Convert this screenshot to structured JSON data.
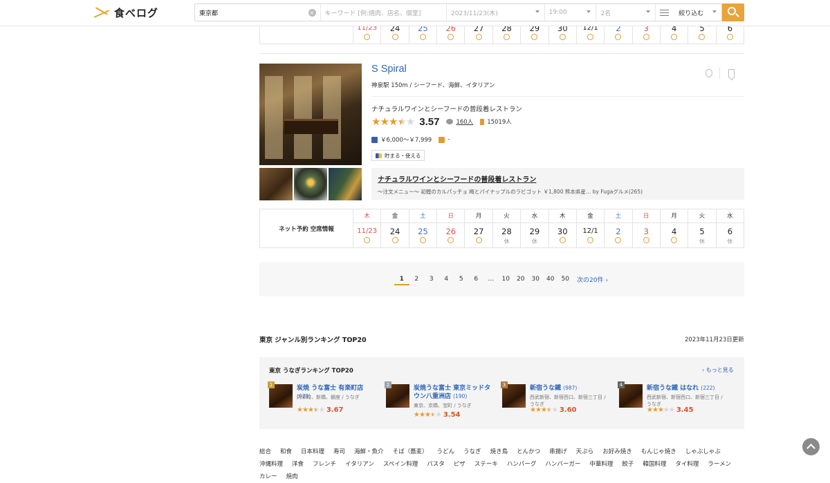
{
  "header": {
    "logo_text": "食べログ",
    "area_value": "東京都",
    "keyword_placeholder": "キーワード [例:焼肉、店名、個室]",
    "date_value": "2023/11/23(木)",
    "time_value": "19:00",
    "people_value": "2名",
    "filter_label": "絞り込む"
  },
  "top_calendar": {
    "days": [
      {
        "date": "11/23",
        "mark": "circle",
        "color": "red"
      },
      {
        "date": "24",
        "mark": "circle",
        "color": ""
      },
      {
        "date": "25",
        "mark": "circle",
        "color": "blue"
      },
      {
        "date": "26",
        "mark": "circle",
        "color": "red"
      },
      {
        "date": "27",
        "mark": "circle",
        "color": ""
      },
      {
        "date": "28",
        "mark": "circle",
        "color": ""
      },
      {
        "date": "29",
        "mark": "circle",
        "color": ""
      },
      {
        "date": "30",
        "mark": "circle",
        "color": ""
      },
      {
        "date": "12/1",
        "mark": "circle",
        "color": ""
      },
      {
        "date": "2",
        "mark": "circle",
        "color": "blue"
      },
      {
        "date": "3",
        "mark": "circle",
        "color": "red"
      },
      {
        "date": "4",
        "mark": "circle",
        "color": ""
      },
      {
        "date": "5",
        "mark": "circle",
        "color": ""
      },
      {
        "date": "6",
        "mark": "circle",
        "color": ""
      }
    ]
  },
  "restaurant": {
    "name": "S Spiral",
    "meta": "神泉駅 150m / シーフード、海鮮、イタリアン",
    "catch": "ナチュラルワインとシーフードの普段着レストラン",
    "score": "3.57",
    "stars_full": 3.5,
    "review_count": "160人",
    "save_count": "15019人",
    "dinner_price": "￥6,000～￥7,999",
    "lunch_price": "-",
    "point_label": "貯まる・使える",
    "review_title": "ナチュラルワインとシーフードの普段着レストラン",
    "review_snippet": "〜注文メニュー〜 初鰹のカルパッチョ 梅とパイナップルのラビゴット ￥1,800 熊本県産…",
    "review_author": "by Fugaグルメ(265)"
  },
  "calendar": {
    "label": "ネット予約 空席情報",
    "days": [
      {
        "wd": "木",
        "date": "11/23",
        "mark": "circle",
        "color": "red"
      },
      {
        "wd": "金",
        "date": "24",
        "mark": "circle",
        "color": ""
      },
      {
        "wd": "土",
        "date": "25",
        "mark": "circle",
        "color": "blue"
      },
      {
        "wd": "日",
        "date": "26",
        "mark": "circle",
        "color": "red"
      },
      {
        "wd": "月",
        "date": "27",
        "mark": "circle",
        "color": ""
      },
      {
        "wd": "火",
        "date": "28",
        "mark": "休",
        "color": ""
      },
      {
        "wd": "水",
        "date": "29",
        "mark": "休",
        "color": ""
      },
      {
        "wd": "木",
        "date": "30",
        "mark": "circle",
        "color": ""
      },
      {
        "wd": "金",
        "date": "12/1",
        "mark": "circle",
        "color": ""
      },
      {
        "wd": "土",
        "date": "2",
        "mark": "circle",
        "color": "blue"
      },
      {
        "wd": "日",
        "date": "3",
        "mark": "circle",
        "color": "red"
      },
      {
        "wd": "月",
        "date": "4",
        "mark": "circle",
        "color": ""
      },
      {
        "wd": "火",
        "date": "5",
        "mark": "休",
        "color": ""
      },
      {
        "wd": "水",
        "date": "6",
        "mark": "休",
        "color": ""
      }
    ]
  },
  "pagination": {
    "pages": [
      "1",
      "2",
      "3",
      "4",
      "5",
      "6",
      "…",
      "10",
      "20",
      "30",
      "40",
      "50"
    ],
    "current": "1",
    "next_label": "次の20件"
  },
  "ranking": {
    "title": "東京 ジャンル別ランキング TOP20",
    "updated": "2023年11月23日更新",
    "box_title": "東京 うなぎランキング TOP20",
    "more_label": "もっと見る",
    "items": [
      {
        "rank": "1",
        "name": "炭焼 うな富士 有楽町店",
        "count": "(979)",
        "area": "内幸町、新橋、銀座 / うなぎ",
        "score": "3.67",
        "stars": 3.5
      },
      {
        "rank": "2",
        "name": "炭焼うな富士 東京ミッドタウン八重洲店",
        "count": "(190)",
        "area": "東京、京橋、宝町 / うなぎ",
        "score": "3.54",
        "stars": 3.5
      },
      {
        "rank": "3",
        "name": "新宿うな鐵",
        "count": "(987)",
        "area": "西武新宿、新宿西口、新宿三丁目 / うなぎ",
        "score": "3.60",
        "stars": 3.5
      },
      {
        "rank": "4",
        "name": "新宿うな鐵 はなれ",
        "count": "(222)",
        "area": "西武新宿、新宿西口、新宿三丁目 / うなぎ",
        "score": "3.45",
        "stars": 3
      }
    ]
  },
  "genres": [
    "総合",
    "和食",
    "日本料理",
    "寿司",
    "海鮮・魚介",
    "そば（蕎麦）",
    "うどん",
    "うなぎ",
    "焼き鳥",
    "とんかつ",
    "串揚げ",
    "天ぷら",
    "お好み焼き",
    "もんじゃ焼き",
    "しゃぶしゃぶ",
    "沖縄料理",
    "洋食",
    "フレンチ",
    "イタリアン",
    "スペイン料理",
    "パスタ",
    "ピザ",
    "ステーキ",
    "ハンバーグ",
    "ハンバーガー",
    "中華料理",
    "餃子",
    "韓国料理",
    "タイ料理",
    "ラーメン",
    "カレー",
    "焼肉"
  ],
  "colors": {
    "accent": "#e39b2f",
    "link": "#2f66b8",
    "sunday": "#d9534f",
    "saturday": "#3d6fc5"
  }
}
